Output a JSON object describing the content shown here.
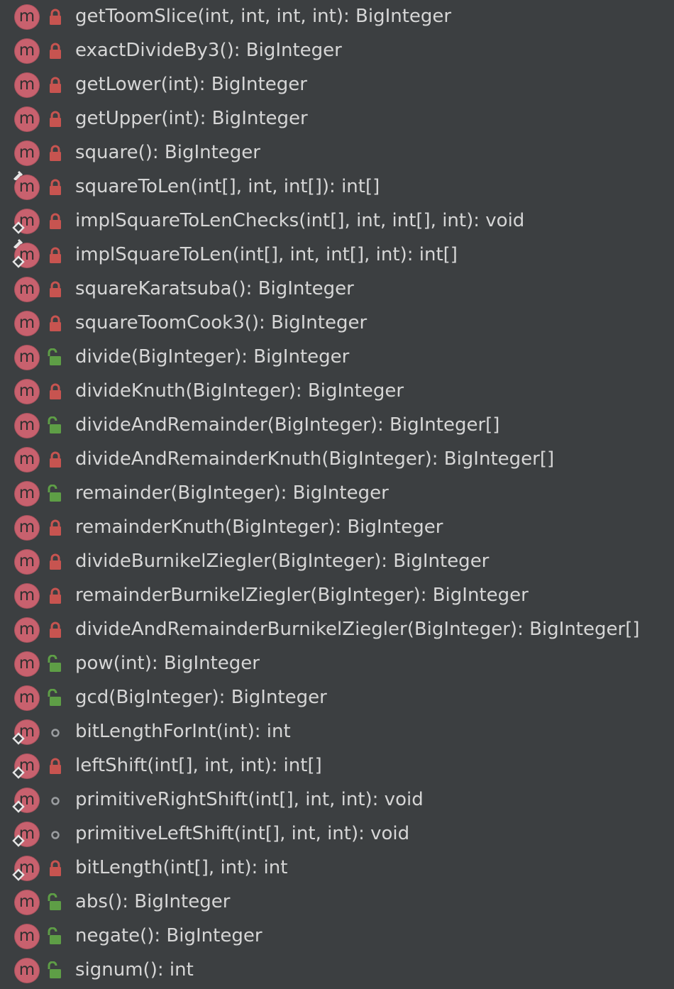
{
  "members": [
    {
      "name": "getToomSlice(int, int, int, int)",
      "type": "BigInteger",
      "visibility": "private",
      "static": false,
      "final": false
    },
    {
      "name": "exactDivideBy3()",
      "type": "BigInteger",
      "visibility": "private",
      "static": false,
      "final": false
    },
    {
      "name": "getLower(int)",
      "type": "BigInteger",
      "visibility": "private",
      "static": false,
      "final": false
    },
    {
      "name": "getUpper(int)",
      "type": "BigInteger",
      "visibility": "private",
      "static": false,
      "final": false
    },
    {
      "name": "square()",
      "type": "BigInteger",
      "visibility": "private",
      "static": false,
      "final": false
    },
    {
      "name": "squareToLen(int[], int, int[])",
      "type": "int[]",
      "visibility": "private",
      "static": true,
      "final": false
    },
    {
      "name": "implSquareToLenChecks(int[], int, int[], int)",
      "type": "void",
      "visibility": "private",
      "static": false,
      "final": true
    },
    {
      "name": "implSquareToLen(int[], int, int[], int)",
      "type": "int[]",
      "visibility": "private",
      "static": true,
      "final": true
    },
    {
      "name": "squareKaratsuba()",
      "type": "BigInteger",
      "visibility": "private",
      "static": false,
      "final": false
    },
    {
      "name": "squareToomCook3()",
      "type": "BigInteger",
      "visibility": "private",
      "static": false,
      "final": false
    },
    {
      "name": "divide(BigInteger)",
      "type": "BigInteger",
      "visibility": "public",
      "static": false,
      "final": false
    },
    {
      "name": "divideKnuth(BigInteger)",
      "type": "BigInteger",
      "visibility": "private",
      "static": false,
      "final": false
    },
    {
      "name": "divideAndRemainder(BigInteger)",
      "type": "BigInteger[]",
      "visibility": "public",
      "static": false,
      "final": false
    },
    {
      "name": "divideAndRemainderKnuth(BigInteger)",
      "type": "BigInteger[]",
      "visibility": "private",
      "static": false,
      "final": false
    },
    {
      "name": "remainder(BigInteger)",
      "type": "BigInteger",
      "visibility": "public",
      "static": false,
      "final": false
    },
    {
      "name": "remainderKnuth(BigInteger)",
      "type": "BigInteger",
      "visibility": "private",
      "static": false,
      "final": false
    },
    {
      "name": "divideBurnikelZiegler(BigInteger)",
      "type": "BigInteger",
      "visibility": "private",
      "static": false,
      "final": false
    },
    {
      "name": "remainderBurnikelZiegler(BigInteger)",
      "type": "BigInteger",
      "visibility": "private",
      "static": false,
      "final": false
    },
    {
      "name": "divideAndRemainderBurnikelZiegler(BigInteger)",
      "type": "BigInteger[]",
      "visibility": "private",
      "static": false,
      "final": false
    },
    {
      "name": "pow(int)",
      "type": "BigInteger",
      "visibility": "public",
      "static": false,
      "final": false
    },
    {
      "name": "gcd(BigInteger)",
      "type": "BigInteger",
      "visibility": "public",
      "static": false,
      "final": false
    },
    {
      "name": "bitLengthForInt(int)",
      "type": "int",
      "visibility": "package",
      "static": false,
      "final": true
    },
    {
      "name": "leftShift(int[], int, int)",
      "type": "int[]",
      "visibility": "private",
      "static": false,
      "final": true
    },
    {
      "name": "primitiveRightShift(int[], int, int)",
      "type": "void",
      "visibility": "package",
      "static": false,
      "final": true
    },
    {
      "name": "primitiveLeftShift(int[], int, int)",
      "type": "void",
      "visibility": "package",
      "static": false,
      "final": true
    },
    {
      "name": "bitLength(int[], int)",
      "type": "int",
      "visibility": "private",
      "static": false,
      "final": true
    },
    {
      "name": "abs()",
      "type": "BigInteger",
      "visibility": "public",
      "static": false,
      "final": false
    },
    {
      "name": "negate()",
      "type": "BigInteger",
      "visibility": "public",
      "static": false,
      "final": false
    },
    {
      "name": "signum()",
      "type": "int",
      "visibility": "public",
      "static": false,
      "final": false
    }
  ],
  "icon_letter": "m",
  "colors": {
    "background": "#3c3f41",
    "method_icon": "#c8616e",
    "private_lock": "#c75450",
    "public_lock": "#5e9e46",
    "package_dot": "#9a9da0",
    "text": "#d6d6d6"
  }
}
